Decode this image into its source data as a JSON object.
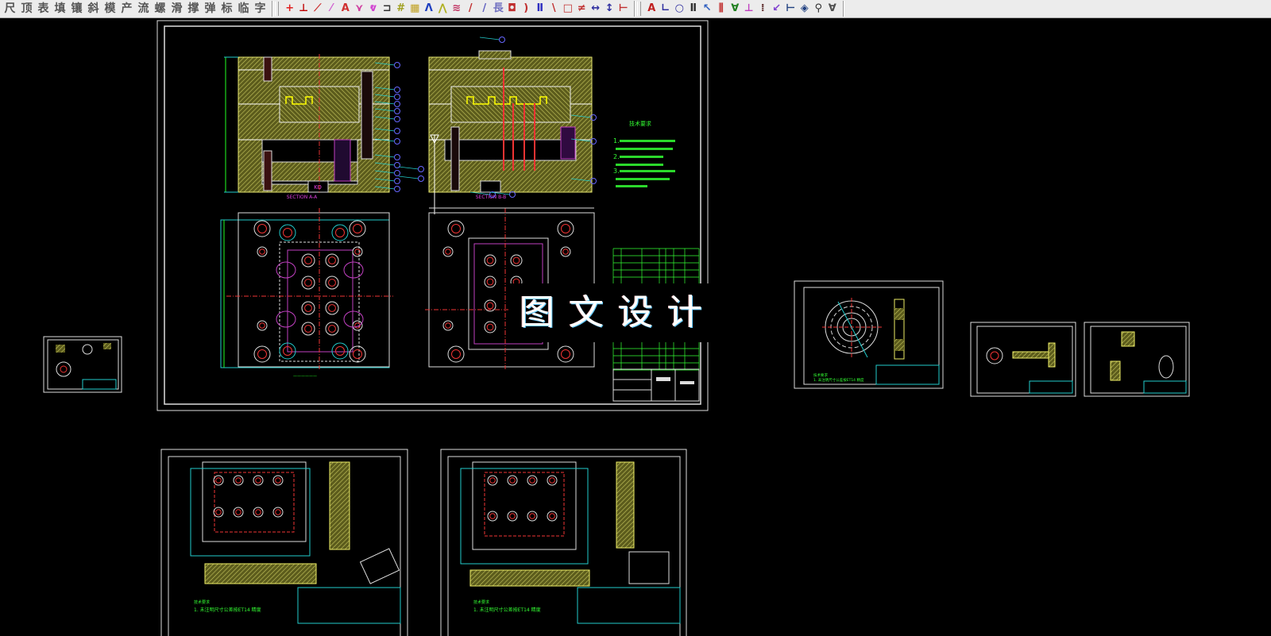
{
  "toolbar": {
    "text_tools": [
      "尺",
      "顶",
      "表",
      "填",
      "镶",
      "斜",
      "模",
      "产",
      "流",
      "螺",
      "滑",
      "撑",
      "弹",
      "标",
      "临",
      "字"
    ],
    "draw_icons": [
      {
        "name": "cross-icon",
        "glyph": "+",
        "color": "#e02020"
      },
      {
        "name": "ejector-icon",
        "glyph": "⊥",
        "color": "#c00000"
      },
      {
        "name": "hatch-line-icon",
        "glyph": "⟋",
        "color": "#cc3333"
      },
      {
        "name": "angle-dim-icon",
        "glyph": "⁄",
        "color": "#d060d0"
      },
      {
        "name": "aa-dim-icon",
        "glyph": "A",
        "color": "#d03030"
      },
      {
        "name": "wave-icon",
        "glyph": "⋎",
        "color": "#d040a0"
      },
      {
        "name": "break-line-icon",
        "glyph": "ⱴ",
        "color": "#d040d0"
      },
      {
        "name": "bracket-icon",
        "glyph": "⊐",
        "color": "#333333"
      },
      {
        "name": "hatch-grid-icon",
        "glyph": "#",
        "color": "#a0a020"
      },
      {
        "name": "color-hatch-icon",
        "glyph": "▦",
        "color": "#c0a020"
      },
      {
        "name": "triangle-icon",
        "glyph": "Λ",
        "color": "#2040c0"
      },
      {
        "name": "light-icon",
        "glyph": "⋀",
        "color": "#b0b020"
      },
      {
        "name": "stripes-icon",
        "glyph": "≋",
        "color": "#c03060"
      },
      {
        "name": "slash-icon",
        "glyph": "/",
        "color": "#c03030"
      },
      {
        "name": "slash2-icon",
        "glyph": "/",
        "color": "#6060c0"
      },
      {
        "name": "long-icon",
        "glyph": "長",
        "color": "#7070c0"
      },
      {
        "name": "box-circle-icon",
        "glyph": "◘",
        "color": "#c03030"
      },
      {
        "name": "arc-icon",
        "glyph": ")",
        "color": "#c03030"
      },
      {
        "name": "dim-between-icon",
        "glyph": "Ⅱ",
        "color": "#3030c0"
      },
      {
        "name": "backslash-icon",
        "glyph": "\\",
        "color": "#c03030"
      },
      {
        "name": "rect-icon",
        "glyph": "□",
        "color": "#c03030"
      },
      {
        "name": "not-equal-icon",
        "glyph": "≠",
        "color": "#c03030"
      },
      {
        "name": "horizontal-dim-icon",
        "glyph": "↔",
        "color": "#3030a0"
      },
      {
        "name": "vertical-dim-icon",
        "glyph": "↕",
        "color": "#3030a0"
      },
      {
        "name": "end-dim-icon",
        "glyph": "⊢",
        "color": "#c03030"
      }
    ],
    "annotate_icons": [
      {
        "name": "text-edit-icon",
        "glyph": "A",
        "color": "#c02020"
      },
      {
        "name": "coord-icon",
        "glyph": "∟",
        "color": "#3030a0"
      },
      {
        "name": "origin-icon",
        "glyph": "○",
        "color": "#3030a0"
      },
      {
        "name": "base-dim-icon",
        "glyph": "Ⅱ",
        "color": "#303030"
      },
      {
        "name": "leader-icon",
        "glyph": "↖",
        "color": "#3060c0"
      },
      {
        "name": "multi-dim-icon",
        "glyph": "⫼",
        "color": "#c03030"
      },
      {
        "name": "surface-icon",
        "glyph": "∀",
        "color": "#208020"
      },
      {
        "name": "tolerance-icon",
        "glyph": "⊥",
        "color": "#c040c0"
      },
      {
        "name": "tick-icon",
        "glyph": "⁞",
        "color": "#603030"
      },
      {
        "name": "curve-arrow-icon",
        "glyph": "↙",
        "color": "#8040d0"
      },
      {
        "name": "span-dim-icon",
        "glyph": "⊢",
        "color": "#204080"
      },
      {
        "name": "rotate-dim-icon",
        "glyph": "◈",
        "color": "#204080"
      },
      {
        "name": "find-icon",
        "glyph": "⚲",
        "color": "#303030"
      },
      {
        "name": "check-icon",
        "glyph": "∀",
        "color": "#505050"
      }
    ]
  },
  "drawing": {
    "watermark": "图文设计",
    "main_sheet": {
      "section_a": "SECTION A-A",
      "section_b": "SECTION B-B",
      "ko_label": "KO",
      "tech_title": "技术要求",
      "tech_notes": [
        "1.",
        "2.",
        "3."
      ]
    },
    "bottom_sheets": {
      "note_title": "技术要求",
      "note_line": "1. 未注明尺寸公差按ET14 精度"
    },
    "part_sheet": {
      "note_title": "技术要求",
      "note_line": "1. 未注明尺寸公差按ET14 精度"
    }
  }
}
